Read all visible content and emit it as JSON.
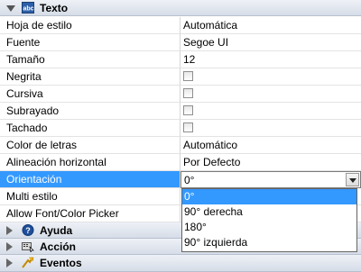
{
  "sections": {
    "texto": {
      "title": "Texto",
      "icon": "text-abc-icon",
      "expanded": true
    },
    "ayuda": {
      "title": "Ayuda",
      "icon": "help-icon",
      "expanded": false
    },
    "accion": {
      "title": "Acción",
      "icon": "action-icon",
      "expanded": false
    },
    "eventos": {
      "title": "Eventos",
      "icon": "events-icon",
      "expanded": false
    }
  },
  "properties": [
    {
      "name": "Hoja de estilo",
      "value": "Automática"
    },
    {
      "name": "Fuente",
      "value": "Segoe UI"
    },
    {
      "name": "Tamaño",
      "value": "12"
    },
    {
      "name": "Negrita",
      "checked": false
    },
    {
      "name": "Cursiva",
      "checked": false
    },
    {
      "name": "Subrayado",
      "checked": false
    },
    {
      "name": "Tachado",
      "checked": false
    },
    {
      "name": "Color de letras",
      "value": "Automático"
    },
    {
      "name": "Alineación horizontal",
      "value": "Por Defecto"
    },
    {
      "name": "Orientación",
      "value": "0°",
      "selected": true
    },
    {
      "name": "Multi estilo",
      "value": ""
    },
    {
      "name": "Allow Font/Color Picker",
      "value": ""
    }
  ],
  "orientation_dropdown": {
    "options": [
      "0°",
      "90° derecha",
      "180°",
      "90° izquierda"
    ],
    "highlighted": "0°"
  },
  "colors": {
    "selection": "#3399ff",
    "header_bg": "#dde3ec"
  }
}
